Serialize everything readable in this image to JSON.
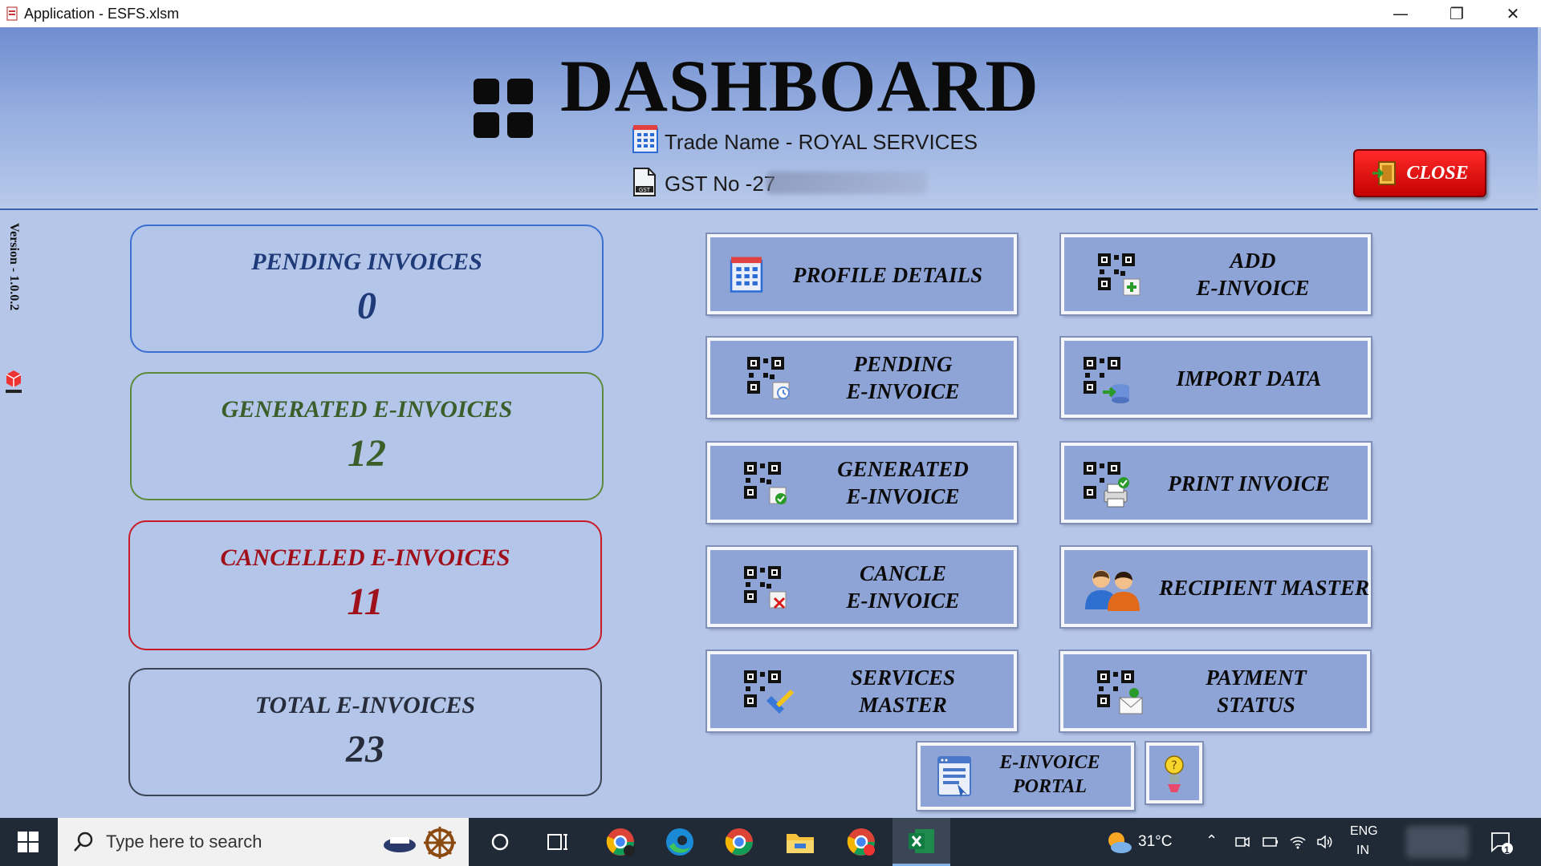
{
  "window": {
    "title": "Application - ESFS.xlsm",
    "minimize": "—",
    "restore": "❐",
    "close": "✕"
  },
  "header": {
    "title": "DASHBOARD",
    "trade_name": "Trade Name - ROYAL SERVICES",
    "gst": "GST No -27",
    "close_label": "CLOSE"
  },
  "version": "Version - 1.0.0.2",
  "cards": [
    {
      "label": "PENDING INVOICES",
      "value": "0",
      "color": "#1f3a78",
      "border": "#3b6fd0"
    },
    {
      "label": "GENERATED E-INVOICES",
      "value": "12",
      "color": "#3b5e2a",
      "border": "#5c8a3c"
    },
    {
      "label": "CANCELLED E-INVOICES",
      "value": "11",
      "color": "#a0101a",
      "border": "#c81a25"
    },
    {
      "label": "TOTAL E-INVOICES",
      "value": "23",
      "color": "#262c3a",
      "border": "#3b4455"
    }
  ],
  "buttons": {
    "profile": "PROFILE DETAILS",
    "add_l1": "ADD",
    "add_l2": "E-INVOICE",
    "pending_l1": "PENDING",
    "pending_l2": "E-INVOICE",
    "import": "IMPORT DATA",
    "generated_l1": "GENERATED",
    "generated_l2": "E-INVOICE",
    "print": "PRINT INVOICE",
    "cancle_l1": "CANCLE",
    "cancle_l2": "E-INVOICE",
    "recipient": "RECIPIENT MASTER",
    "services_l1": "SERVICES",
    "services_l2": "MASTER",
    "payment_l1": "PAYMENT",
    "payment_l2": "STATUS",
    "portal_l1": "E-INVOICE",
    "portal_l2": "PORTAL"
  },
  "taskbar": {
    "search_placeholder": "Type here to search",
    "weather": "31°C",
    "lang_1": "ENG",
    "lang_2": "IN",
    "notifications": "1"
  }
}
